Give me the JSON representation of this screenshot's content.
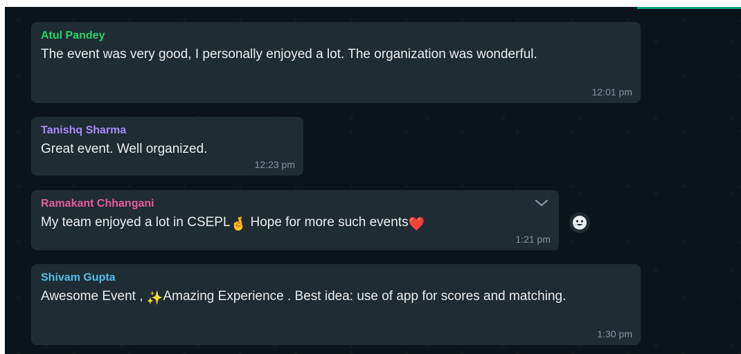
{
  "messages": [
    {
      "sender": "Atul Pandey",
      "sender_color": "#25d366",
      "text": "The event was very good, I personally enjoyed a lot. The organization was wonderful.",
      "time": "12:01 pm"
    },
    {
      "sender": "Tanishq Sharma",
      "sender_color": "#a78bfa",
      "text": "Great event. Well organized.",
      "time": "12:23 pm"
    },
    {
      "sender": "Ramakant Chhangani",
      "sender_color": "#e85d9b",
      "text_part1": "My team enjoyed a lot in CSEPL",
      "text_part2": " Hope for more such events",
      "emoji_1": "🤞",
      "emoji_2": "❤️",
      "time": "1:21 pm"
    },
    {
      "sender": "Shivam Gupta",
      "sender_color": "#53bdeb",
      "text_part1": "Awesome Event , ",
      "emoji_1": "✨",
      "text_part2": "Amazing Experience . Best idea: use of app for scores and matching.",
      "time": "1:30 pm"
    }
  ],
  "icons": {
    "menu": "chevron-down-icon",
    "reaction": "smiley-icon"
  },
  "colors": {
    "background": "#0b141a",
    "bubble": "#202c33",
    "text": "#e9edef",
    "timestamp": "#8696a0",
    "accent": "#00a884"
  }
}
